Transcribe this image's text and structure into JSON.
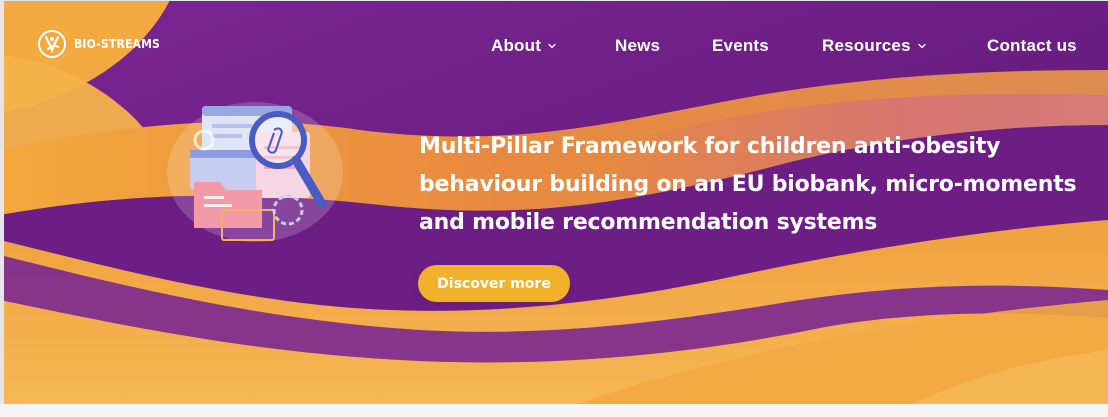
{
  "brand": {
    "name": "BIO-STREAMS",
    "logo_icon": "bio-streams-logo-icon"
  },
  "nav": {
    "items": [
      {
        "label": "About",
        "has_dropdown": true
      },
      {
        "label": "News",
        "has_dropdown": false
      },
      {
        "label": "Events",
        "has_dropdown": false
      },
      {
        "label": "Resources",
        "has_dropdown": true
      },
      {
        "label": "Contact us",
        "has_dropdown": false
      }
    ]
  },
  "hero": {
    "headline_lines": [
      "Multi-Pillar Framework for children anti-obesity",
      "behaviour building on an EU biobank, micro-moments",
      "and mobile recommendation systems"
    ],
    "cta_label": "Discover more",
    "illustration": "magnifier-documents-illustration"
  },
  "colors": {
    "purple": "#6b1e83",
    "deep_purple": "#5a1570",
    "orange": "#f0a53a",
    "cta": "#f2b12a",
    "text": "#ffffff"
  }
}
